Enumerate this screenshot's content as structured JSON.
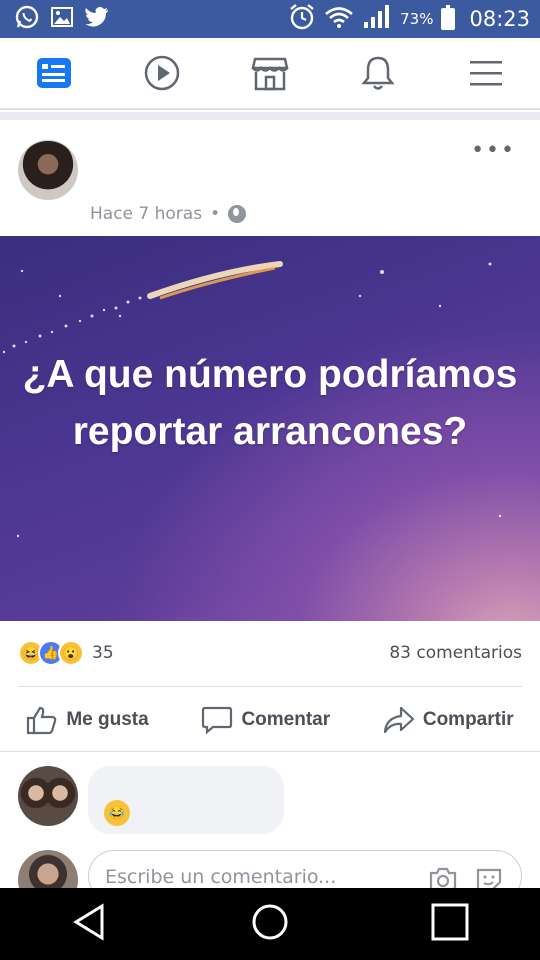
{
  "status_bar": {
    "battery_percent": "73%",
    "time": "08:23",
    "left_icons": [
      "whatsapp-icon",
      "gallery-icon",
      "twitter-icon"
    ],
    "right_icons": [
      "alarm-icon",
      "wifi-icon",
      "signal-icon",
      "battery-icon"
    ]
  },
  "nav": {
    "items": [
      {
        "name": "news-feed",
        "active": true
      },
      {
        "name": "watch",
        "active": false
      },
      {
        "name": "marketplace",
        "active": false
      },
      {
        "name": "notifications",
        "active": false
      },
      {
        "name": "menu",
        "active": false
      }
    ],
    "accent": "#1877f2"
  },
  "post": {
    "time": "Hace 7 horas",
    "separator": "•",
    "privacy_icon": "globe-icon",
    "more_label": "•••",
    "hero_text": "¿A que número podríamos reportar arrancones?",
    "hero_colors": [
      "#3b2e7e",
      "#5b3c99",
      "#d9a1b8"
    ]
  },
  "reactions": {
    "types": [
      "haha",
      "like",
      "wow"
    ],
    "count": "35",
    "comments_label": "83 comentarios"
  },
  "actions": {
    "like": "Me gusta",
    "comment": "Comentar",
    "share": "Compartir"
  },
  "composer": {
    "placeholder": "Escribe un comentario..."
  }
}
